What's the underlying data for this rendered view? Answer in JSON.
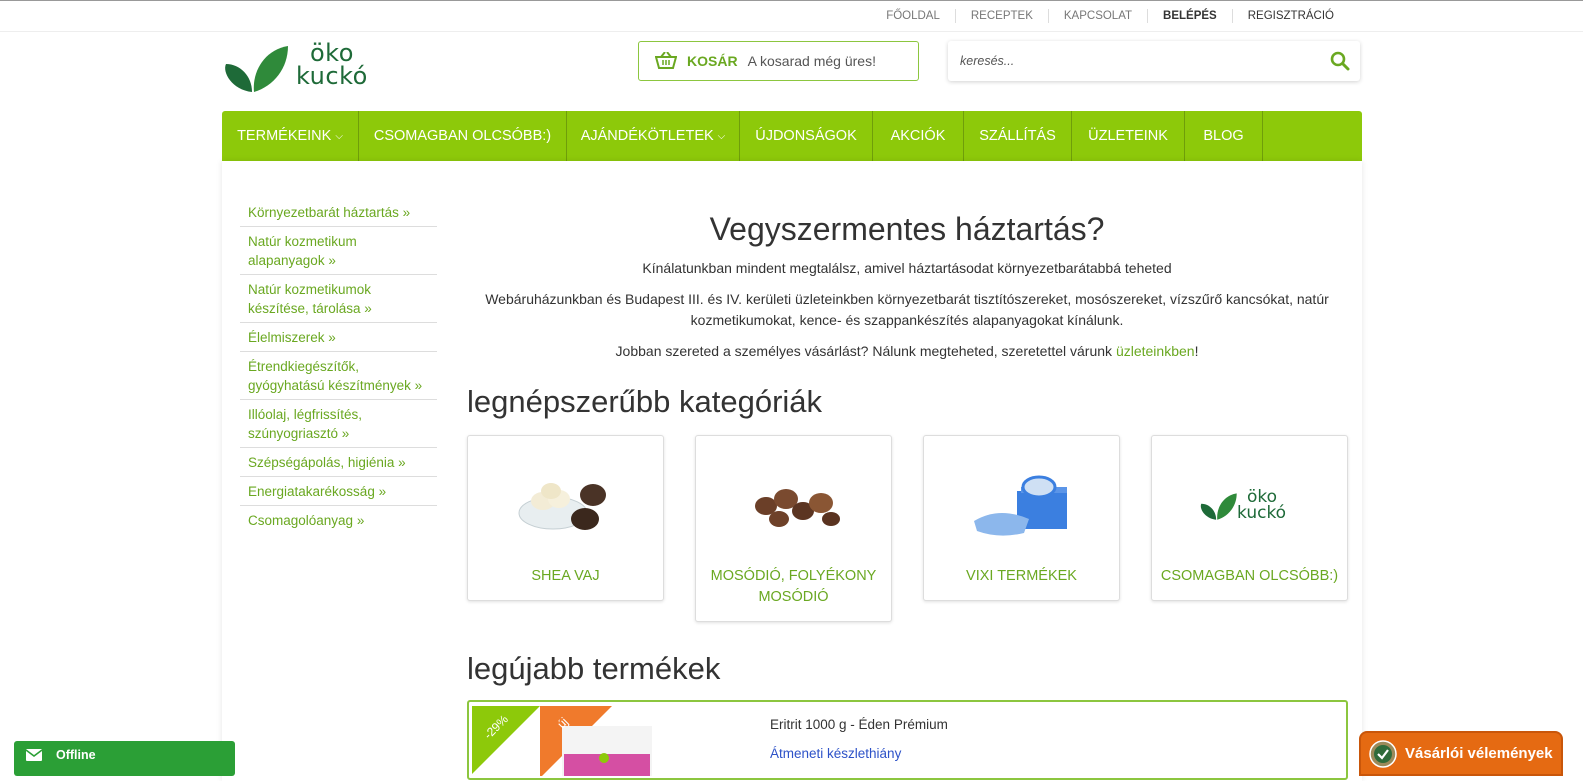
{
  "topbar": {
    "links": [
      "FŐOLDAL",
      "RECEPTEK",
      "KAPCSOLAT",
      "BELÉPÉS",
      "REGISZTRÁCIÓ"
    ]
  },
  "logo": {
    "line1": "öko",
    "line2": "kuckó"
  },
  "cart": {
    "label": "KOSÁR",
    "status": "A kosarad még üres!",
    "icon": "basket-icon"
  },
  "search": {
    "placeholder": "keresés...",
    "icon": "search-icon"
  },
  "nav": {
    "items": [
      {
        "label": "TERMÉKEINK",
        "dropdown": true
      },
      {
        "label": "CSOMAGBAN OLCSÓBB:)",
        "dropdown": false
      },
      {
        "label": "AJÁNDÉKÖTLETEK",
        "dropdown": true
      },
      {
        "label": "ÚJDONSÁGOK",
        "dropdown": false
      },
      {
        "label": "AKCIÓK",
        "dropdown": false
      },
      {
        "label": "SZÁLLÍTÁS",
        "dropdown": false
      },
      {
        "label": "ÜZLETEINK",
        "dropdown": false
      },
      {
        "label": "BLOG",
        "dropdown": false
      }
    ]
  },
  "sidebar": {
    "items": [
      {
        "label": "Környezetbarát háztartás »"
      },
      {
        "label": "Natúr kozmetikum alapanyagok »"
      },
      {
        "label": "Natúr kozmetikumok készítése, tárolása »"
      },
      {
        "label": "Élelmiszerek »"
      },
      {
        "label": "Étrendkiegészítők, gyógyhatású készítmények »"
      },
      {
        "label": "Illóolaj, légfrissítés, szúnyogriasztó »"
      },
      {
        "label": "Szépségápolás, higiénia »"
      },
      {
        "label": "Energiatakarékosság »"
      },
      {
        "label": "Csomagolóanyag »"
      }
    ]
  },
  "hero": {
    "title": "Vegyszermentes háztartás?",
    "p1": "Kínálatunkban mindent megtalálsz, amivel háztartásodat környezetbarátabbá teheted",
    "p2": "Webáruházunkban és Budapest III. és IV. kerületi üzleteinkben környezetbarát tisztítószereket, mosószereket, vízszűrő kancsókat, natúr kozmetikumokat, kence- és szappankészítés alapanyagokat kínálunk.",
    "p3_before": "Jobban szereted a személyes vásárlást? Nálunk megteheted, szeretettel várunk ",
    "p3_link": "üzleteinkben",
    "p3_after": "!"
  },
  "categories": {
    "title": "legnépszerűbb kategóriák",
    "items": [
      {
        "name": "SHEA VAJ"
      },
      {
        "name": "MOSÓDIÓ, FOLYÉKONY MOSÓDIÓ"
      },
      {
        "name": "VIXI TERMÉKEK"
      },
      {
        "name": "CSOMAGBAN OLCSÓBB:)"
      }
    ],
    "logo_line1": "öko",
    "logo_line2": "kuckó"
  },
  "newest": {
    "title": "legújabb termékek",
    "product_name": "Eritrit 1000 g - Éden Prémium",
    "stock": "Átmeneti készlethiány",
    "discount_badge": "-29%",
    "new_badge": "új"
  },
  "chat": {
    "label": "Offline",
    "icon": "envelope-icon"
  },
  "reviews": {
    "label": "Vásárlói vélemények",
    "icon": "checkmark-badge-icon"
  },
  "colors": {
    "brand_green": "#8dc90a",
    "link_green": "#6aa821",
    "dark_green": "#1e6a38",
    "orange": "#e56a12",
    "stock_blue": "#2d52c8"
  }
}
